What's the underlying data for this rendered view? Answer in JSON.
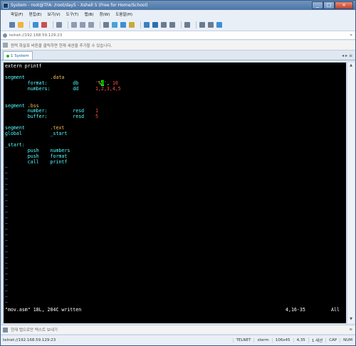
{
  "window": {
    "title": "System - root@TFA: /root/day5 - Xshell 5 (Free for Home/School)"
  },
  "menu": [
    "파일(F)",
    "편집(E)",
    "보기(V)",
    "도구(T)",
    "탭(B)",
    "창(W)",
    "도움말(H)"
  ],
  "address": {
    "value": "telnet://192.168.59.129:23"
  },
  "info": {
    "text": "원력 화살표 버튼을 클릭하면 현재 세션을 추가할 수 있습니다."
  },
  "tab": {
    "label": "1 System"
  },
  "terminal": {
    "lines": [
      [
        {
          "t": "extern printf",
          "c": "w"
        }
      ],
      [],
      [
        {
          "t": "segment         ",
          "c": "k"
        },
        {
          "t": ".data",
          "c": "o"
        }
      ],
      [
        {
          "t": "        format:         db      ",
          "c": "k"
        },
        {
          "t": "'",
          "c": "r"
        },
        {
          "t": "%",
          "c": "y"
        },
        {
          "t": "d",
          "c": "g"
        },
        {
          "t": "'",
          "c": "r"
        },
        {
          "t": ", ",
          "c": "w"
        },
        {
          "t": "10",
          "c": "r"
        }
      ],
      [
        {
          "t": "        numbers:        dd      ",
          "c": "k"
        },
        {
          "t": "1,2,3,4,5",
          "c": "r"
        }
      ],
      [],
      [],
      [
        {
          "t": "segment ",
          "c": "k"
        },
        {
          "t": ".bss",
          "c": "o"
        }
      ],
      [
        {
          "t": "        number:         resd    ",
          "c": "k"
        },
        {
          "t": "1",
          "c": "r"
        }
      ],
      [
        {
          "t": "        buffer:         resd    ",
          "c": "k"
        },
        {
          "t": "5",
          "c": "r"
        }
      ],
      [],
      [
        {
          "t": "segment         ",
          "c": "k"
        },
        {
          "t": ".text",
          "c": "o"
        }
      ],
      [
        {
          "t": "global          _start",
          "c": "k"
        }
      ],
      [],
      [
        {
          "t": "_start:",
          "c": "k"
        }
      ],
      [
        {
          "t": "        push    numbers",
          "c": "k"
        }
      ],
      [
        {
          "t": "        push    format",
          "c": "k"
        }
      ],
      [
        {
          "t": "        call    printf",
          "c": "k"
        }
      ]
    ],
    "tilde": "~",
    "tilde_count": 25,
    "status_left": "\"mov.asm\" 18L, 204C written",
    "status_pos": "4,16-35",
    "status_all": "All"
  },
  "compose": {
    "text": "현재 탭으로만 텍스트 보내기"
  },
  "statusbar": {
    "host": "telnet://192.168.59.129:23",
    "proto": "TELNET",
    "term": "xterm",
    "size": "106x45",
    "cursor": "4,35",
    "sessions": "1 세션",
    "cap": "CAP",
    "num": "NUM"
  }
}
